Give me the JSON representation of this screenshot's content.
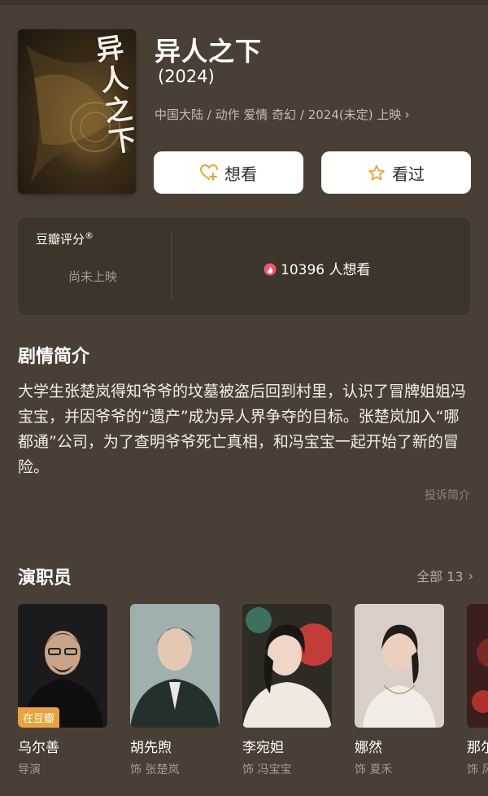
{
  "movie": {
    "title": "异人之下",
    "year": "(2024)",
    "meta": "中国大陆 / 动作 爱情 奇幻 / 2024(未定) 上映",
    "poster_text": "异人之下"
  },
  "actions": {
    "want_label": "想看",
    "seen_label": "看过",
    "want_icon": "heart-plus-icon",
    "seen_icon": "star-outline-icon"
  },
  "rating": {
    "label": "豆瓣评分",
    "registered_mark": "®",
    "status": "尚未上映",
    "wish_count_text": "10396 人想看",
    "flame_color": "#f0566b"
  },
  "synopsis": {
    "heading": "剧情简介",
    "text": "大学生张楚岚得知爷爷的坟墓被盗后回到村里，认识了冒牌姐姐冯宝宝，并因爷爷的“遗产”成为异人界争夺的目标。张楚岚加入“哪都通”公司，为了查明爷爷死亡真相，和冯宝宝一起开始了新的冒险。",
    "report_label": "投诉简介"
  },
  "cast": {
    "heading": "演职员",
    "all_label": "全部 13",
    "tag_label": "在豆瓣",
    "members": [
      {
        "name": "乌尔善",
        "role": "导演"
      },
      {
        "name": "胡先煦",
        "role": "饰 张楚岚"
      },
      {
        "name": "李宛妲",
        "role": "饰 冯宝宝"
      },
      {
        "name": "娜然",
        "role": "饰 夏禾"
      },
      {
        "name": "那尔",
        "role": "饰 风"
      }
    ]
  },
  "colors": {
    "background": "#4a3f34",
    "card": "#3d342a",
    "accent": "#e8a33c"
  }
}
